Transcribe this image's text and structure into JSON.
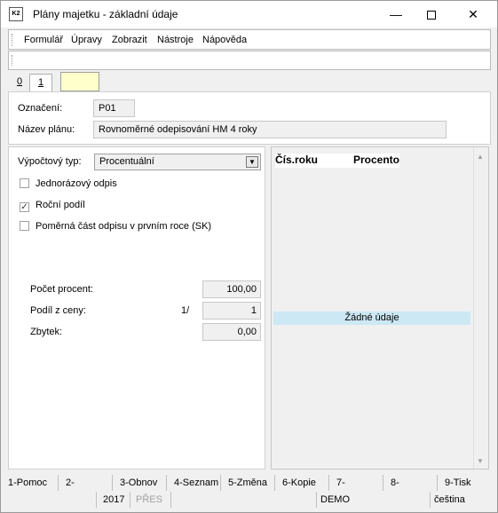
{
  "window": {
    "title": "Plány majetku - základní údaje",
    "icon_text": "K2",
    "minimize_glyph": "—",
    "close_glyph": "✕"
  },
  "menu": {
    "items": [
      {
        "label": "Formulář"
      },
      {
        "label": "Úpravy"
      },
      {
        "label": "Zobrazit"
      },
      {
        "label": "Nástroje"
      },
      {
        "label": "Nápověda"
      }
    ]
  },
  "tabs": [
    {
      "label": "0"
    },
    {
      "label": "1"
    }
  ],
  "header": {
    "code_label": "Označení:",
    "code_value": "P01",
    "name_label": "Název plánu:",
    "name_value": "Rovnoměrné odepisování HM 4 roky"
  },
  "calc": {
    "type_label": "Výpočtový typ:",
    "type_value": "Procentuální",
    "checkboxes": [
      {
        "label": "Jednorázový odpis",
        "checked": false
      },
      {
        "label": "Roční podíl",
        "checked": true
      },
      {
        "label": "Poměrná část odpisu v prvním roce (SK)",
        "checked": false
      }
    ],
    "count_label": "Počet procent:",
    "count_value": "100,00",
    "share_label": "Podíl z ceny:",
    "share_prefix": "1/",
    "share_value": "1",
    "rest_label": "Zbytek:",
    "rest_value": "0,00",
    "check_glyph": "✓"
  },
  "grid": {
    "columns": [
      "Čís.roku",
      "Procento"
    ],
    "empty_text": "Žádné údaje",
    "scroll_up": "▲",
    "scroll_down": "▼"
  },
  "fkeys": [
    "1-Pomoc",
    "2-",
    "3-Obnov",
    "4-Seznam",
    "5-Změna",
    "6-Kopie",
    "7-",
    "8-",
    "9-Tisk"
  ],
  "status": {
    "year": "2017",
    "mode": "PŘES",
    "db": "DEMO",
    "lang": "čeština"
  }
}
